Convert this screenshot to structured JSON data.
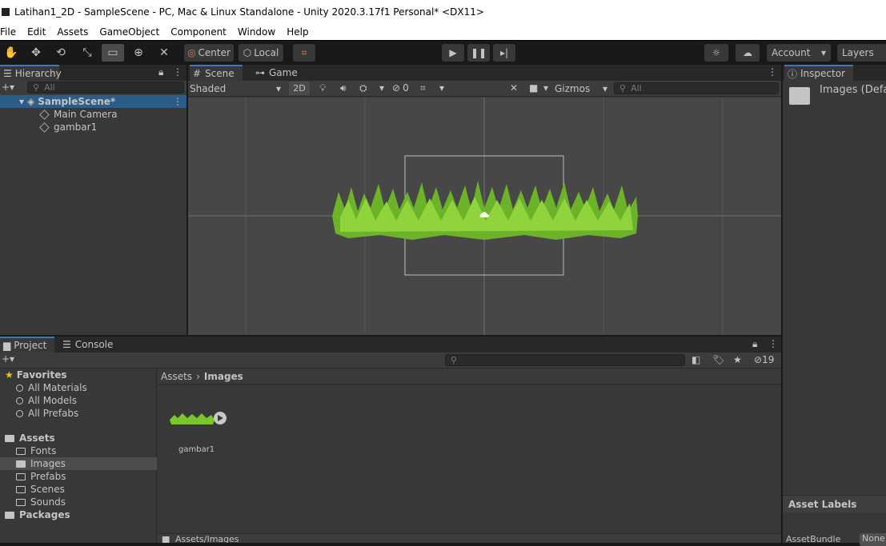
{
  "window": {
    "title": "Latihan1_2D - SampleScene - PC, Mac & Linux Standalone - Unity 2020.3.17f1 Personal* <DX11>"
  },
  "menu": {
    "items": [
      "File",
      "Edit",
      "Assets",
      "GameObject",
      "Component",
      "Window",
      "Help"
    ]
  },
  "toolbar": {
    "pivot_label": "Center",
    "space_label": "Local",
    "account_label": "Account",
    "layers_label": "Layers"
  },
  "hierarchy": {
    "tab_label": "Hierarchy",
    "search_placeholder": "All",
    "scene_name": "SampleScene*",
    "objects": [
      "Main Camera",
      "gambar1"
    ]
  },
  "scene_view": {
    "tabs": [
      "Scene",
      "Game"
    ],
    "shading_mode": "Shaded",
    "mode_2d": "2D",
    "hidden_count": "0",
    "gizmos_label": "Gizmos",
    "search_placeholder": "All"
  },
  "inspector": {
    "tab_label": "Inspector",
    "title": "Images (Defa",
    "asset_labels": "Asset Labels",
    "asset_bundle_label": "AssetBundle",
    "asset_bundle_value": "None"
  },
  "project": {
    "tabs": [
      "Project",
      "Console"
    ],
    "hidden_count": "19",
    "breadcrumb": [
      "Assets",
      "Images"
    ],
    "favorites": {
      "label": "Favorites",
      "items": [
        "All Materials",
        "All Models",
        "All Prefabs"
      ]
    },
    "assets": {
      "label": "Assets",
      "folders": [
        "Fonts",
        "Images",
        "Prefabs",
        "Scenes",
        "Sounds"
      ]
    },
    "packages_label": "Packages",
    "files": [
      {
        "name": "gambar1"
      }
    ],
    "path_bar": "Assets/Images"
  },
  "colors": {
    "accent": "#3a79bb",
    "selection": "#4d4d4d",
    "grass": "#7bc62f"
  }
}
